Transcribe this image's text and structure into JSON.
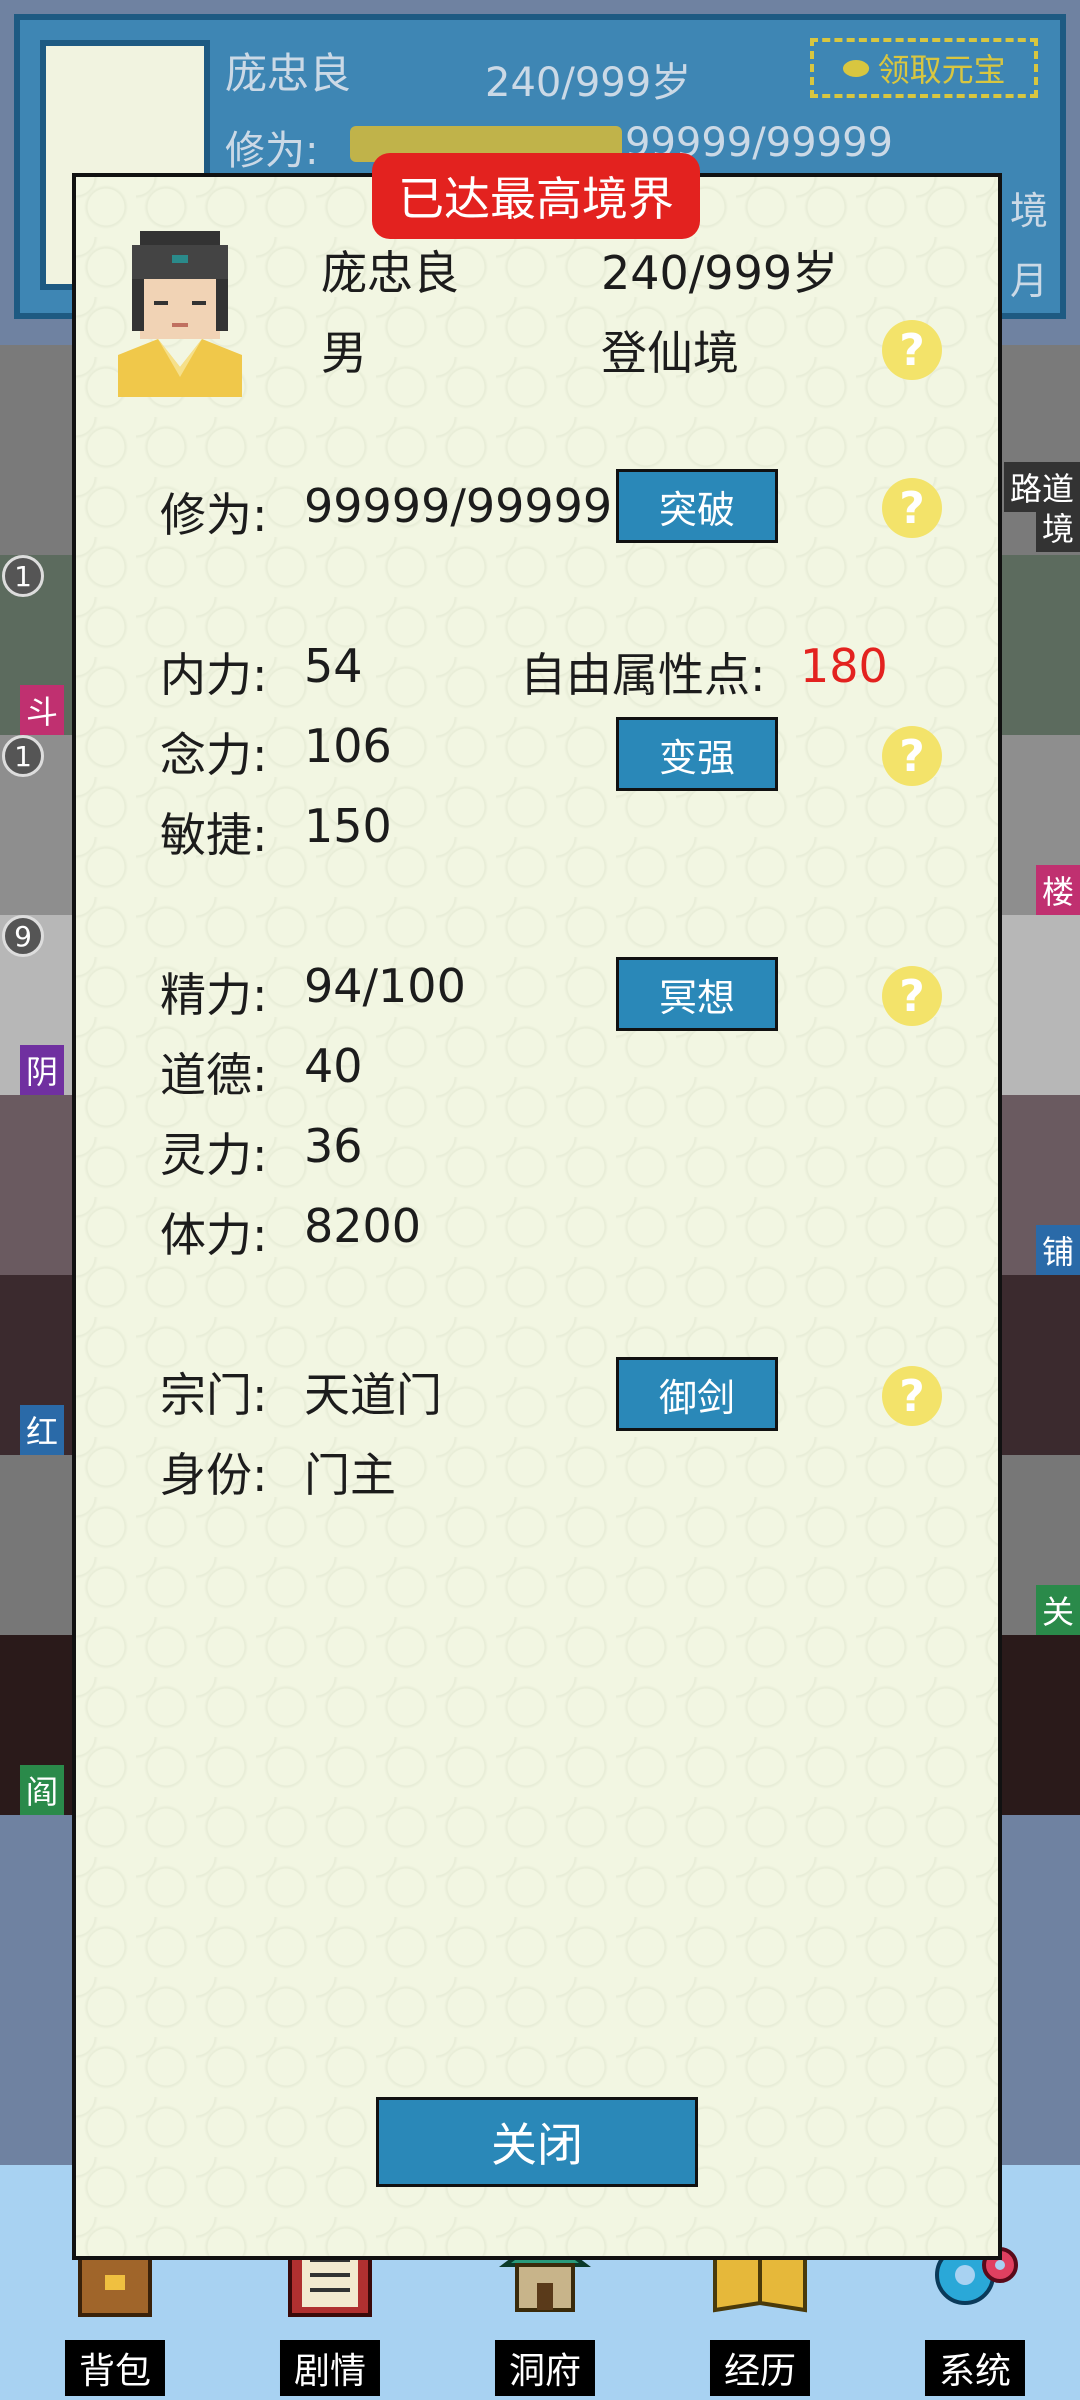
{
  "background": {
    "name": "庞忠良",
    "age": "240/999岁",
    "cultivation_label": "修为:",
    "cultivation_value": "99999/99999",
    "claim_button": "领取元宝",
    "realm_fragment": "境",
    "month_fragment": "月",
    "map_tags_left": [
      "斗",
      "阴",
      "红",
      "阎"
    ],
    "map_badges_left": [
      "1",
      "1",
      "9"
    ],
    "map_tags_right": [
      "楼",
      "铺",
      "关"
    ],
    "map_sign_right": [
      "路道",
      "境"
    ]
  },
  "modal": {
    "ribbon": "已达最高境界",
    "name": "庞忠良",
    "age": "240/999岁",
    "gender": "男",
    "realm": "登仙境",
    "cultivation_label": "修为:",
    "cultivation_value": "99999/99999",
    "breakthrough_button": "突破",
    "neili_label": "内力:",
    "neili_value": "54",
    "free_points_label": "自由属性点:",
    "free_points_value": "180",
    "nianli_label": "念力:",
    "nianli_value": "106",
    "strengthen_button": "变强",
    "minjie_label": "敏捷:",
    "minjie_value": "150",
    "jingli_label": "精力:",
    "jingli_value": "94/100",
    "meditate_button": "冥想",
    "daode_label": "道德:",
    "daode_value": "40",
    "lingli_label": "灵力:",
    "lingli_value": "36",
    "tili_label": "体力:",
    "tili_value": "8200",
    "sect_label": "宗门:",
    "sect_value": "天道门",
    "fly_sword_button": "御剑",
    "identity_label": "身份:",
    "identity_value": "门主",
    "help_mark": "?",
    "close_button": "关闭"
  },
  "bottom_nav": [
    {
      "label": "背包",
      "icon": "backpack-icon"
    },
    {
      "label": "剧情",
      "icon": "story-icon"
    },
    {
      "label": "洞府",
      "icon": "cave-dwelling-icon"
    },
    {
      "label": "经历",
      "icon": "experience-icon"
    },
    {
      "label": "系统",
      "icon": "settings-gear-icon"
    }
  ],
  "colors": {
    "accent_blue": "#2a88b8",
    "ribbon_red": "#e3221f",
    "help_yellow": "#f3e36a",
    "panel_bg": "#f2f6e2"
  }
}
